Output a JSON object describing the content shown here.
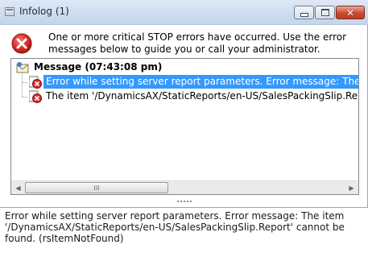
{
  "window": {
    "title": "Infolog (1)",
    "controls": {
      "minimize": "minimize",
      "maximize": "maximize",
      "close": "close"
    }
  },
  "header": {
    "icon": "error-stop-icon",
    "message": "One or more critical STOP errors have occurred. Use the error messages below to guide you or call your administrator."
  },
  "tree": {
    "root": {
      "icon": "message-envelope-icon",
      "label": "Message (07:43:08 pm)"
    },
    "items": [
      {
        "icon": "error-item-icon",
        "label": "Error while setting server report parameters. Error message: The item '/D",
        "selected": true
      },
      {
        "icon": "error-item-icon",
        "label": "The item '/DynamicsAX/StaticReports/en-US/SalesPackingSlip.Report' c",
        "selected": false
      }
    ],
    "scrollbar": {
      "thumb_grip": "III"
    }
  },
  "detail": {
    "text": "Error while setting server report parameters. Error message: The item '/DynamicsAX/StaticReports/en-US/SalesPackingSlip.Report' cannot be found. (rsItemNotFound)"
  },
  "colors": {
    "selection": "#3399ff",
    "error_red": "#d62b2b",
    "titlebar": "#cddcee"
  }
}
